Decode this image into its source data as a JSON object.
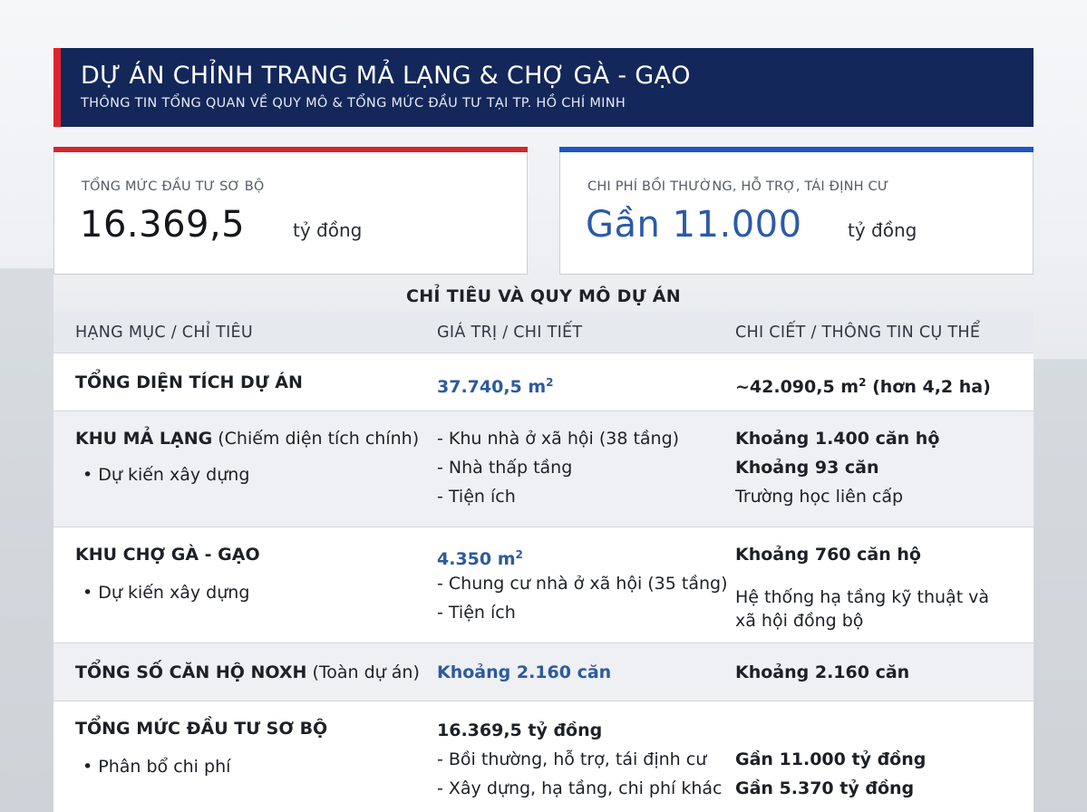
{
  "header": {
    "title": "DỰ ÁN CHỈNH TRANG MẢ LẠNG & CHỢ GÀ - GẠO",
    "subtitle": "THÔNG TIN TỔNG QUAN VỀ QUY MÔ & TỔNG MỨC ĐẦU TƯ TẠI TP. HỒ CHÍ MINH"
  },
  "stats": [
    {
      "label": "TỔNG MỨC ĐẦU TƯ SƠ BỘ",
      "value": "16.369,5",
      "unit": "tỷ đồng",
      "accent": "#d5262d"
    },
    {
      "label": "CHI PHÍ BỒI THƯỜNG, HỖ TRỢ, TÁI ĐỊNH CƯ",
      "value": "Gần 11.000",
      "unit": "tỷ đồng",
      "accent": "#1f55c5"
    }
  ],
  "section_title": "CHỈ TIÊU VÀ QUY MÔ DỰ ÁN",
  "table": {
    "headers": [
      "HẠNG MỤC / CHỈ TIÊU",
      "GIÁ TRỊ / CHI TIẾT",
      "CHI CIẾT / THÔNG TIN CỤ THỂ"
    ],
    "rows": [
      {
        "name": "TỔNG DIỆN TÍCH DỰ ÁN",
        "value": "37.740,5 m",
        "value_sup": "2",
        "info": "~42.090,5 m",
        "info_sup": "2",
        "info_rest": " (hơn 4,2 ha)"
      },
      {
        "name": "KHU MẢ LẠNG",
        "name_note": " (Chiếm diện tích chính)",
        "sub": "• Dự kiến xây dựng",
        "items": [
          "- Khu nhà ở xã hội (38 tầng)",
          "- Nhà thấp tầng",
          "- Tiện ích"
        ],
        "details": [
          "Khoảng 1.400 căn hộ",
          "Khoảng 93 căn",
          "Trường học liên cấp"
        ]
      },
      {
        "name": "KHU CHỢ GÀ - GẠO",
        "sub": "• Dự kiến xây dựng",
        "value": "4.350 m",
        "value_sup": "2",
        "items": [
          "- Chung cư nhà ở xã hội (35 tầng)",
          "- Tiện ích"
        ],
        "details": [
          "Khoảng 760 căn hộ",
          "Hệ thống hạ tầng kỹ thuật và",
          "xã hội đồng bộ"
        ]
      },
      {
        "name": "TỔNG SỐ CĂN HỘ NOXH",
        "name_note": " (Toàn dự án)",
        "value": "Khoảng 2.160 căn",
        "info": "Khoảng 2.160 căn"
      },
      {
        "name": "TỔNG MỨC ĐẦU TƯ SƠ BỘ",
        "sub": "• Phân bổ chi phí",
        "value": "16.369,5 tỷ đồng",
        "items": [
          "- Bồi thường, hỗ trợ, tái định cư",
          "- Xây dựng, hạ tầng, chi phí khác"
        ],
        "details": [
          "Gần 11.000 tỷ đồng",
          "Gần 5.370 tỷ đồng"
        ]
      }
    ]
  }
}
